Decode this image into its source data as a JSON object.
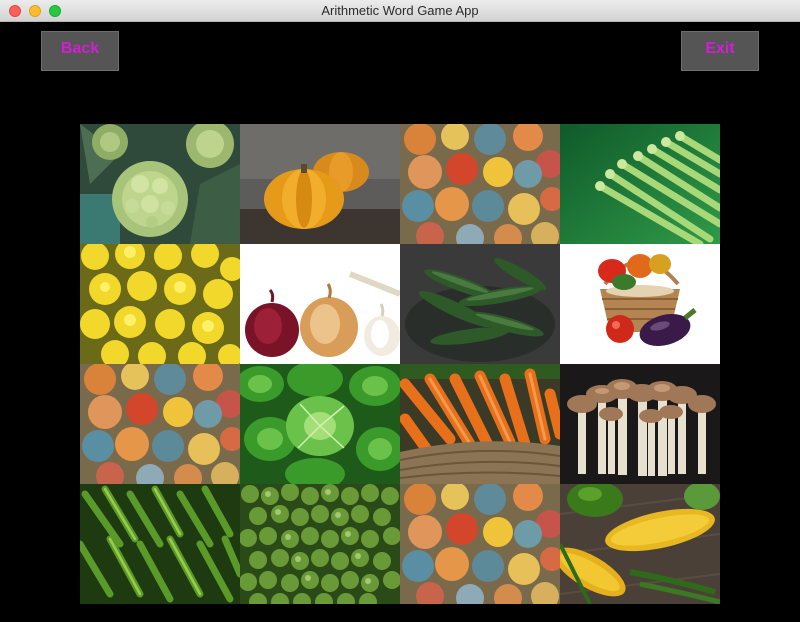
{
  "window": {
    "title": "Arithmetic Word Game App"
  },
  "buttons": {
    "back": "Back",
    "exit": "Exit"
  },
  "colors": {
    "button_text": "#d21fd2",
    "button_bg": "#555555",
    "background": "#000000"
  },
  "tiles": [
    {
      "name": "romanesco-tile",
      "icon": "romanesco-image"
    },
    {
      "name": "pumpkins-tile",
      "icon": "pumpkin-image"
    },
    {
      "name": "squash-pile-tile",
      "icon": "squash-pile-image"
    },
    {
      "name": "asparagus-tile",
      "icon": "asparagus-image"
    },
    {
      "name": "yellow-squash-tile",
      "icon": "yellow-squash-image"
    },
    {
      "name": "onions-garlic-tile",
      "icon": "onion-garlic-image"
    },
    {
      "name": "pea-pods-tile",
      "icon": "pea-pods-image"
    },
    {
      "name": "vegetable-basket-tile",
      "icon": "basket-image"
    },
    {
      "name": "squash-pile-tile-2",
      "icon": "squash-pile-image"
    },
    {
      "name": "lettuce-tile",
      "icon": "lettuce-image"
    },
    {
      "name": "carrots-tile",
      "icon": "carrots-image"
    },
    {
      "name": "mushrooms-tile",
      "icon": "mushrooms-image"
    },
    {
      "name": "green-peppers-tile",
      "icon": "peppers-image"
    },
    {
      "name": "brussels-sprouts-tile",
      "icon": "sprouts-image"
    },
    {
      "name": "squash-pile-tile-3",
      "icon": "squash-pile-image"
    },
    {
      "name": "corn-tile",
      "icon": "corn-image"
    }
  ]
}
